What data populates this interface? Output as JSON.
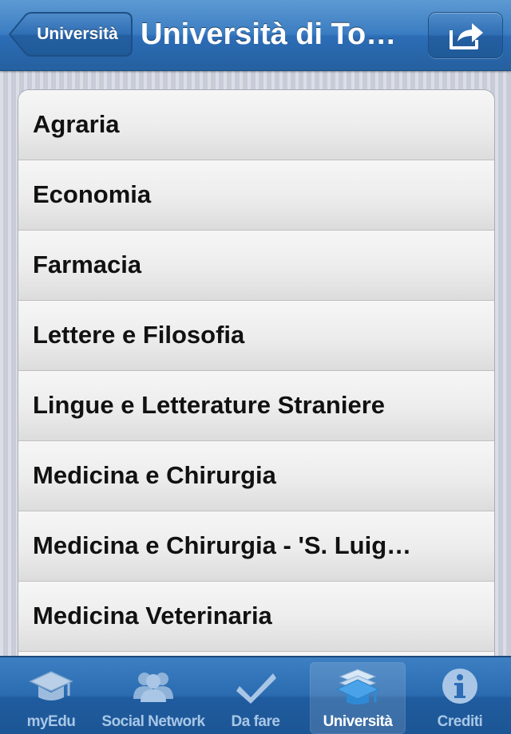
{
  "navbar": {
    "back_label": "Università",
    "title": "Università di To…",
    "share_icon": "share-icon"
  },
  "list": {
    "items": [
      {
        "label": "Agraria"
      },
      {
        "label": "Economia"
      },
      {
        "label": "Farmacia"
      },
      {
        "label": "Lettere e Filosofia"
      },
      {
        "label": "Lingue e Letterature Straniere"
      },
      {
        "label": "Medicina e Chirurgia"
      },
      {
        "label": "Medicina e Chirurgia - 'S. Luig…"
      },
      {
        "label": "Medicina Veterinaria"
      }
    ]
  },
  "tabbar": {
    "tabs": [
      {
        "label": "myEdu",
        "icon": "graduation-cap-icon",
        "selected": false
      },
      {
        "label": "Social Network",
        "icon": "people-icon",
        "selected": false
      },
      {
        "label": "Da fare",
        "icon": "checkmark-icon",
        "selected": false
      },
      {
        "label": "Università",
        "icon": "stacked-caps-icon",
        "selected": true
      },
      {
        "label": "Crediti",
        "icon": "info-icon",
        "selected": false
      }
    ]
  },
  "colors": {
    "bar_blue": "#2c6db6",
    "selected_tab_text": "#ffffff",
    "unselected_tab_text": "#a8c7e6",
    "row_text": "#111111"
  }
}
